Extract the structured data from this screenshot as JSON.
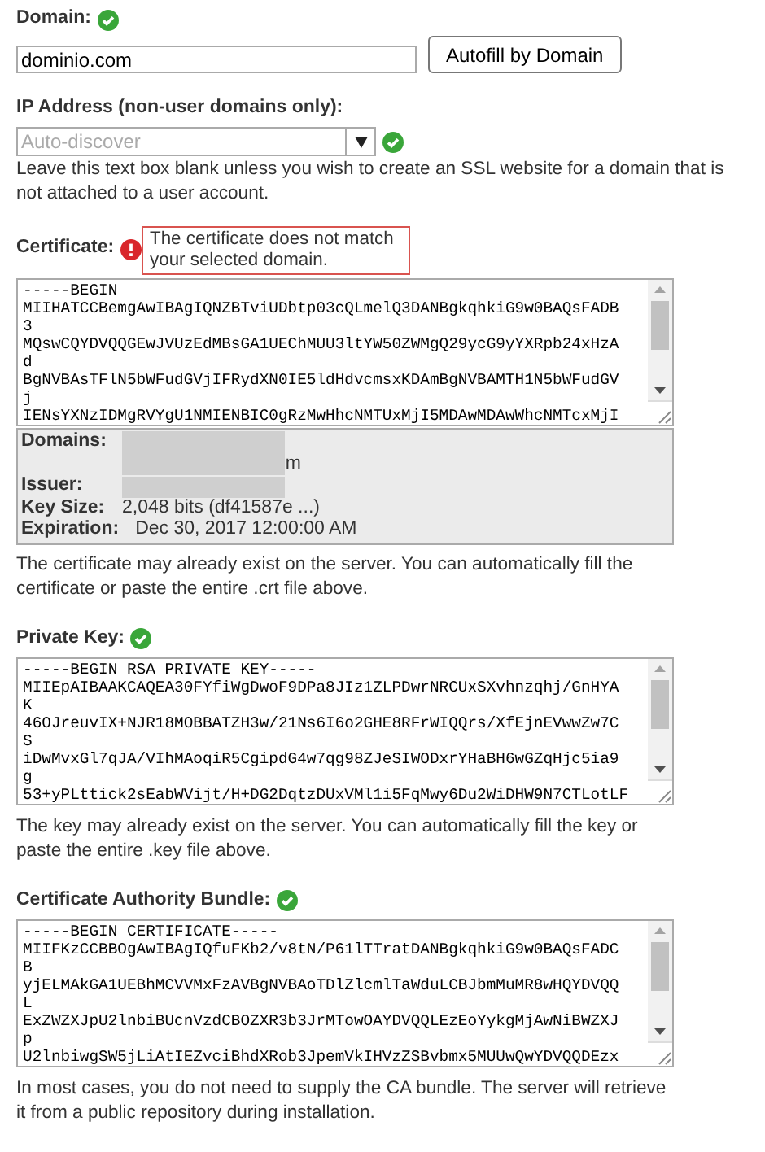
{
  "domain": {
    "label": "Domain:",
    "valid": true,
    "value": "dominio.com",
    "autofill_button": "Autofill by Domain"
  },
  "ip_address": {
    "label": "IP Address (non-user domains only):",
    "valid": true,
    "placeholder": "Auto-discover",
    "help": "Leave this text box blank unless you wish to create an SSL website for a domain that is not attached to a user account."
  },
  "certificate": {
    "label": "Certificate:",
    "valid": false,
    "tooltip": "The certificate does not match your selected domain.",
    "lines": [
      "-----BEGIN",
      "MIIHATCCBemgAwIBAgIQNZBTviUDbtp03cQLmelQ3DANBgkqhkiG9w0BAQsFADB",
      "3",
      "MQswCQYDVQQGEwJVUzEdMBsGA1UEChMUU3ltYW50ZWMgQ29ycG9yYXRpb24xHzA",
      "d",
      "BgNVBAsTFlN5bWFudGVjIFRydXN0IE5ldHdvcmsxKDAmBgNVBAMTH1N5bWFudGV",
      "j",
      "IENsYXNzIDMgRVYgU1NMIENBIC0gRzMwHhcNMTUxMjI5MDAwMDAwWhcNMTcxMjI"
    ],
    "details": [
      {
        "label": "Domains:",
        "kind": "redacted",
        "value": "m"
      },
      {
        "label": "Issuer:",
        "kind": "redacted"
      },
      {
        "label": "Key Size:",
        "kind": "text",
        "value": "2,048 bits (df41587e ...)"
      },
      {
        "label": "Expiration:",
        "kind": "text",
        "value": "Dec 30, 2017 12:00:00 AM"
      }
    ],
    "help": "The certificate may already exist on the server. You can automatically fill the certificate or paste the entire .crt file above."
  },
  "private_key": {
    "label": "Private Key:",
    "valid": true,
    "lines": [
      "-----BEGIN RSA PRIVATE KEY-----",
      "MIIEpAIBAAKCAQEA30FYfiWgDwoF9DPa8JIz1ZLPDwrNRCUxSXvhnzqhj/GnHYA",
      "K",
      "46OJreuvIX+NJR18MOBBATZH3w/21Ns6I6o2GHE8RFrWIQQrs/XfEjnEVwwZw7C",
      "S",
      "iDwMvxGl7qJA/VIhMAoqiR5CgipdG4w7qg98ZJeSIWODxrYHaBH6wGZqHjc5ia9",
      "g",
      "53+yPLttick2sEabWVijt/H+DG2DqtzDUxVMl1i5FqMwy6Du2WiDHW9N7CTLotLF"
    ],
    "help": "The key may already exist on the server. You can automatically fill the key or paste the entire .key file above."
  },
  "ca_bundle": {
    "label": "Certificate Authority Bundle:",
    "valid": true,
    "lines": [
      "-----BEGIN CERTIFICATE-----",
      "MIIFKzCCBBOgAwIBAgIQfuFKb2/v8tN/P61lTTratDANBgkqhkiG9w0BAQsFADC",
      "B",
      "yjELMAkGA1UEBhMCVVMxFzAVBgNVBAoTDlZlcmlTaWduLCBJbmMuMR8wHQYDVQQ",
      "L",
      "ExZWZXJpU2lnbiBUcnVzdCBOZXR3b3JrMTowOAYDVQQLEzEoYykgMjAwNiBWZXJ",
      "p",
      "U2lnbiwgSW5jLiAtIEZvciBhdXRob3JpemVkIHVzZSBvbmx5MUUwQwYDVQQDEzx"
    ],
    "help": "In most cases, you do not need to supply the CA bundle. The server will retrieve it from a public repository during installation."
  }
}
